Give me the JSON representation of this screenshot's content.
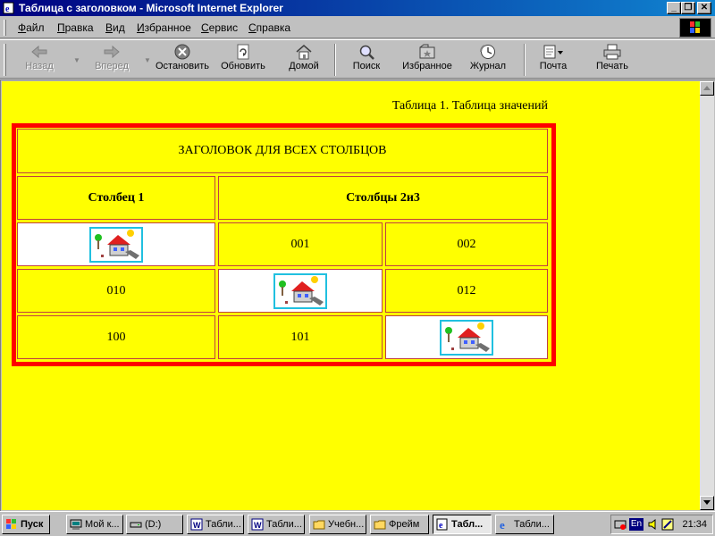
{
  "window": {
    "title": "Таблица с заголовком - Microsoft Internet Explorer",
    "controls": {
      "minimize": "_",
      "maximize": "❐",
      "close": "✕"
    }
  },
  "menu": {
    "items": [
      {
        "underline": "Ф",
        "rest": "айл"
      },
      {
        "underline": "П",
        "rest": "равка"
      },
      {
        "underline": "В",
        "rest": "ид"
      },
      {
        "underline": "И",
        "rest": "збранное"
      },
      {
        "underline": "С",
        "rest": "ервис"
      },
      {
        "underline": "С",
        "rest": "правка"
      }
    ]
  },
  "toolbar": {
    "back": "Назад",
    "forward": "Вперед",
    "stop": "Остановить",
    "refresh": "Обновить",
    "home": "Домой",
    "search": "Поиск",
    "favorites": "Избранное",
    "history": "Журнал",
    "mail": "Почта",
    "print": "Печать",
    "icons": [
      "back-arrow-icon",
      "forward-arrow-icon",
      "stop-icon",
      "refresh-icon",
      "home-icon",
      "search-icon",
      "favorites-icon",
      "history-icon",
      "mail-icon",
      "print-icon"
    ]
  },
  "page": {
    "background": "#ffff00",
    "border_color": "#ff0000",
    "caption": "Таблица 1. Таблица значений",
    "table": {
      "header_all": "ЗАГОЛОВОК ДЛЯ ВСЕХ СТОЛБЦОВ",
      "header_col1": "Столбец 1",
      "header_col23": "Столбцы 2и3",
      "rows": [
        [
          "[image]",
          "001",
          "002"
        ],
        [
          "010",
          "[image]",
          "012"
        ],
        [
          "100",
          "101",
          "[image]"
        ]
      ]
    }
  },
  "taskbar": {
    "start": "Пуск",
    "tasks": [
      "Мой к...",
      "(D:)",
      "Табли...",
      "Табли...",
      "Учебн...",
      "Фрейм",
      "Табл...",
      "Табли..."
    ],
    "active_index": 6,
    "lang": "En",
    "clock": "21:34"
  }
}
